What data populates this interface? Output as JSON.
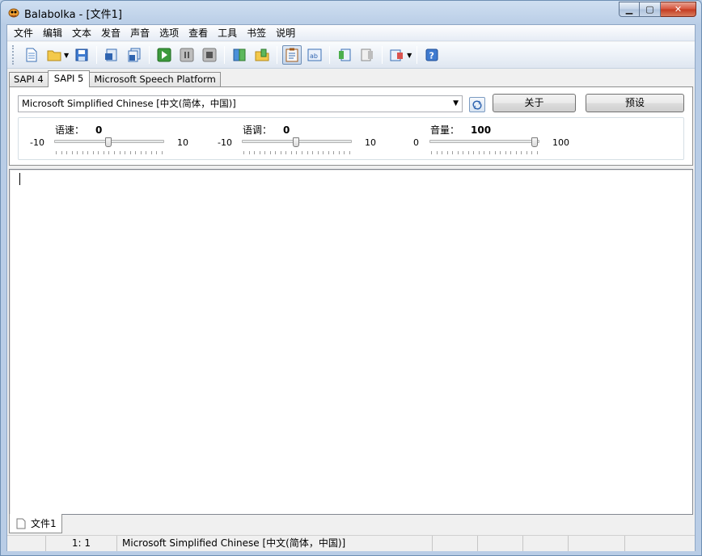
{
  "window": {
    "title": "Balabolka - [文件1]"
  },
  "menu": [
    "文件",
    "编辑",
    "文本",
    "发音",
    "声音",
    "选项",
    "查看",
    "工具",
    "书签",
    "说明"
  ],
  "sapi_tabs": [
    "SAPI 4",
    "SAPI 5",
    "Microsoft Speech Platform"
  ],
  "voice": {
    "selected": "Microsoft Simplified Chinese [中文(简体，中国)]",
    "about_label": "关于",
    "preset_label": "预设"
  },
  "sliders": {
    "rate": {
      "label": "语速：",
      "value": "0",
      "min": "-10",
      "max": "10",
      "level": 0.5
    },
    "pitch": {
      "label": "语调：",
      "value": "0",
      "min": "-10",
      "max": "10",
      "level": 0.5
    },
    "volume": {
      "label": "音量：",
      "value": "100",
      "min": "0",
      "max": "100",
      "level": 1.0
    }
  },
  "doc_tab": {
    "label": "文件1"
  },
  "status": {
    "position": "1:   1",
    "voice": "Microsoft Simplified Chinese [中文(简体，中国)]"
  },
  "colors": {
    "title_bar": "#b9cde6",
    "close_button": "#c33a20",
    "panel_bg": "#f0f0f0"
  }
}
